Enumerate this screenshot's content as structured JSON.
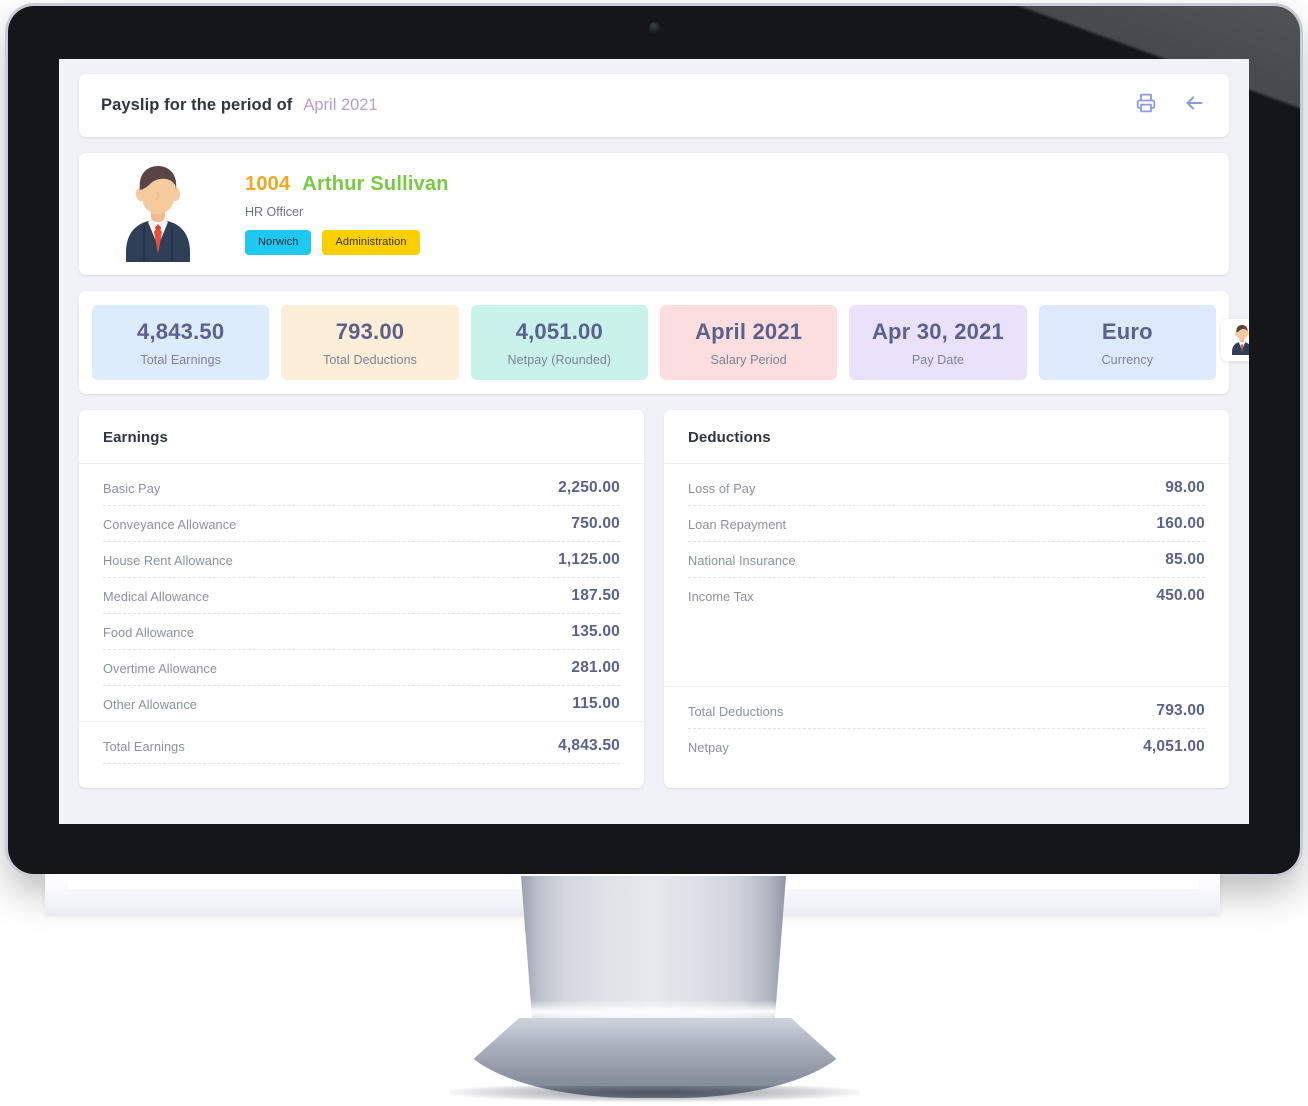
{
  "header": {
    "title": "Payslip for the period of",
    "period": "April 2021",
    "print_icon": "printer-icon",
    "back_icon": "back-arrow-icon",
    "icon_color": "#8c9ade"
  },
  "employee": {
    "id": "1004",
    "name": "Arthur Sullivan",
    "role": "HR Officer",
    "id_color": "#f5a623",
    "name_color": "#7ac943",
    "tags": [
      {
        "label": "Norwich",
        "color": "#1ec8f0"
      },
      {
        "label": "Administration",
        "color": "#fcd000"
      }
    ],
    "avatar_icon": "employee-avatar-icon"
  },
  "stats": [
    {
      "value": "4,843.50",
      "label": "Total Earnings",
      "bg": "#ddecfd"
    },
    {
      "value": "793.00",
      "label": "Total Deductions",
      "bg": "#fdeed7"
    },
    {
      "value": "4,051.00",
      "label": "Netpay (Rounded)",
      "bg": "#c9f2ea"
    },
    {
      "value": "April 2021",
      "label": "Salary Period",
      "bg": "#fcdede"
    },
    {
      "value": "Apr 30, 2021",
      "label": "Pay Date",
      "bg": "#eae2fb"
    },
    {
      "value": "Euro",
      "label": "Currency",
      "bg": "#ddeafd"
    }
  ],
  "mini_avatar_icon": "employee-avatar-thumbnail-icon",
  "earnings": {
    "title": "Earnings",
    "rows": [
      {
        "label": "Basic Pay",
        "value": "2,250.00"
      },
      {
        "label": "Conveyance Allowance",
        "value": "750.00"
      },
      {
        "label": "House Rent Allowance",
        "value": "1,125.00"
      },
      {
        "label": "Medical Allowance",
        "value": "187.50"
      },
      {
        "label": "Food Allowance",
        "value": "135.00"
      },
      {
        "label": "Overtime Allowance",
        "value": "281.00"
      },
      {
        "label": "Other Allowance",
        "value": "115.00"
      }
    ],
    "totals": [
      {
        "label": "Total Earnings",
        "value": "4,843.50"
      }
    ]
  },
  "deductions": {
    "title": "Deductions",
    "rows": [
      {
        "label": "Loss of Pay",
        "value": "98.00"
      },
      {
        "label": "Loan Repayment",
        "value": "160.00"
      },
      {
        "label": "National Insurance",
        "value": "85.00"
      },
      {
        "label": "Income Tax",
        "value": "450.00"
      }
    ],
    "totals": [
      {
        "label": "Total Deductions",
        "value": "793.00"
      },
      {
        "label": "Netpay",
        "value": "4,051.00"
      }
    ]
  }
}
